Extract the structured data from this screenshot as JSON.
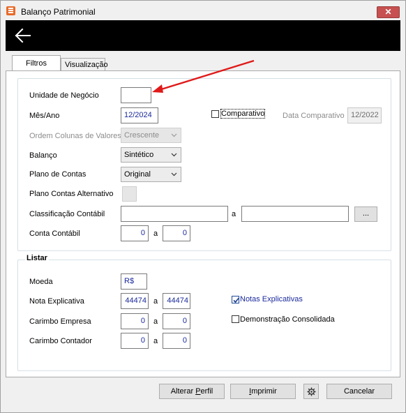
{
  "window": {
    "title": "Balanço Patrimonial",
    "close_label": "✕"
  },
  "tabs": [
    {
      "label": "Filtros",
      "active": true
    },
    {
      "label": "Visualização",
      "active": false
    }
  ],
  "filters": {
    "unidade_label": "Unidade de Negócio",
    "unidade_value": "",
    "mes_ano_label": "Mês/Ano",
    "mes_ano_value": "12/2024",
    "comparativo_label": "Comparativo",
    "comparativo_checked": false,
    "data_comparativo_label": "Data Comparativo",
    "data_comparativo_value": "12/2022",
    "ordem_label": "Ordem Colunas de Valores",
    "ordem_value": "Crescente",
    "balanco_label": "Balanço",
    "balanco_value": "Sintético",
    "plano_label": "Plano de Contas",
    "plano_value": "Original",
    "plano_alt_label": "Plano Contas Alternativo",
    "classificacao_label": "Classificação Contábil",
    "classificacao_from": "",
    "classificacao_sep": "a",
    "classificacao_to": "",
    "browse_label": "...",
    "conta_label": "Conta Contábil",
    "conta_from": "0",
    "conta_sep": "a",
    "conta_to": "0"
  },
  "listar": {
    "title": "Listar",
    "moeda_label": "Moeda",
    "moeda_value": "R$",
    "nota_label": "Nota Explicativa",
    "nota_from": "44474",
    "nota_sep": "a",
    "nota_to": "44474",
    "notas_cb_label": "Notas Explicativas",
    "notas_cb_checked": true,
    "carimbo_emp_label": "Carimbo Empresa",
    "carimbo_emp_from": "0",
    "carimbo_emp_sep": "a",
    "carimbo_emp_to": "0",
    "demo_cb_label": "Demonstração Consolidada",
    "demo_cb_checked": false,
    "carimbo_cont_label": "Carimbo Contador",
    "carimbo_cont_from": "0",
    "carimbo_cont_sep": "a",
    "carimbo_cont_to": "0"
  },
  "footer": {
    "alterar_pre": "Alterar ",
    "alterar_u": "P",
    "alterar_post": "erfil",
    "imprimir_u": "I",
    "imprimir_post": "mprimir",
    "cancelar_label": "Cancelar"
  },
  "colors": {
    "header": "#000000",
    "value_text": "#1a2a9c",
    "annotation_arrow": "#e01a1a",
    "close": "#c75050"
  },
  "icons": [
    "app-icon",
    "back-arrow-icon",
    "chevron-down-icon",
    "gear-icon",
    "checkmark-icon",
    "red-arrow-annotation"
  ]
}
